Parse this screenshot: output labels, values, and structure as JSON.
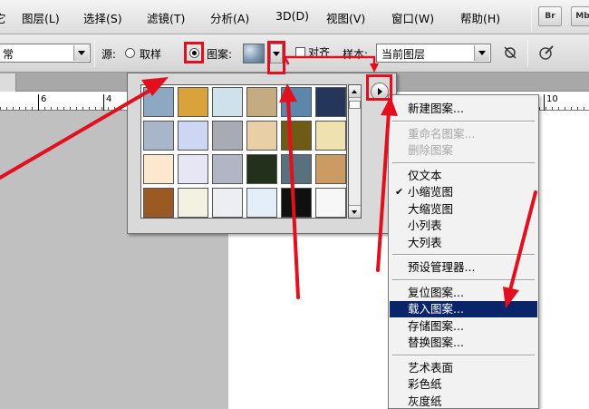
{
  "menubar": {
    "items": [
      "它",
      "图层(L)",
      "选择(S)",
      "滤镜(T)",
      "分析(A)",
      "3D(D)",
      "视图(V)",
      "窗口(W)",
      "帮助(H)"
    ],
    "app_buttons": [
      "Br",
      "Mb"
    ]
  },
  "options": {
    "mode_value": "常",
    "source_label": "源:",
    "sampled_label": "取样",
    "pattern_label": "图案:",
    "aligned_label": "对齐",
    "sample_label": "样本:",
    "sample_value": "当前图层",
    "icons": [
      "ignore-adjustment-icon",
      "pressure-icon"
    ]
  },
  "ruler": {
    "labels": [
      "6",
      "4",
      "10"
    ]
  },
  "picker": {
    "swatches": [
      {
        "name": "bubbles",
        "color": "#8ea7c2"
      },
      {
        "name": "tie-dye",
        "color": "#d9a23a"
      },
      {
        "name": "light-blue",
        "color": "#cfe1ea"
      },
      {
        "name": "tan-paper",
        "color": "#c4ab82"
      },
      {
        "name": "blue-water",
        "color": "#5d86ad"
      },
      {
        "name": "navy",
        "color": "#24375a"
      },
      {
        "name": "gray-blue",
        "color": "#a9b5c8"
      },
      {
        "name": "lavender",
        "color": "#cdd7f4"
      },
      {
        "name": "gray-weave",
        "color": "#a8aab4"
      },
      {
        "name": "beige",
        "color": "#e8cfa5"
      },
      {
        "name": "olive",
        "color": "#6f5b14"
      },
      {
        "name": "straw",
        "color": "#efe2b0"
      },
      {
        "name": "cream",
        "color": "#fbe8cf"
      },
      {
        "name": "pale-lilac",
        "color": "#e6e6f5"
      },
      {
        "name": "gray-fiber",
        "color": "#b2b6c4"
      },
      {
        "name": "dark-green",
        "color": "#23301c"
      },
      {
        "name": "slate",
        "color": "#59707d"
      },
      {
        "name": "sand",
        "color": "#cc9a63"
      },
      {
        "name": "wood",
        "color": "#9a5a22"
      },
      {
        "name": "white-flecks",
        "color": "#f3f1e2"
      },
      {
        "name": "pale-stone",
        "color": "#eceef2"
      },
      {
        "name": "pale-blue",
        "color": "#e3eef8"
      },
      {
        "name": "black",
        "color": "#101010"
      },
      {
        "name": "white",
        "color": "#f7f7f7"
      }
    ]
  },
  "flyout": {
    "items": [
      {
        "label": "新建图案...",
        "disabled": false
      },
      {
        "sep": true
      },
      {
        "label": "重命名图案...",
        "disabled": true
      },
      {
        "label": "删除图案",
        "disabled": true
      },
      {
        "sep": true
      },
      {
        "label": "仅文本",
        "disabled": false
      },
      {
        "label": "小缩览图",
        "disabled": false,
        "checked": true
      },
      {
        "label": "大缩览图",
        "disabled": false
      },
      {
        "label": "小列表",
        "disabled": false
      },
      {
        "label": "大列表",
        "disabled": false
      },
      {
        "sep": true
      },
      {
        "label": "预设管理器...",
        "disabled": false
      },
      {
        "sep": true
      },
      {
        "label": "复位图案...",
        "disabled": false
      },
      {
        "label": "载入图案...",
        "disabled": false,
        "highlighted": true
      },
      {
        "label": "存储图案...",
        "disabled": false
      },
      {
        "label": "替换图案...",
        "disabled": false
      },
      {
        "sep": true
      },
      {
        "label": "艺术表面",
        "disabled": false
      },
      {
        "label": "彩色纸",
        "disabled": false
      },
      {
        "label": "灰度纸",
        "disabled": false
      }
    ],
    "check_mark": "✔"
  },
  "annotation_color": "#e2101e"
}
